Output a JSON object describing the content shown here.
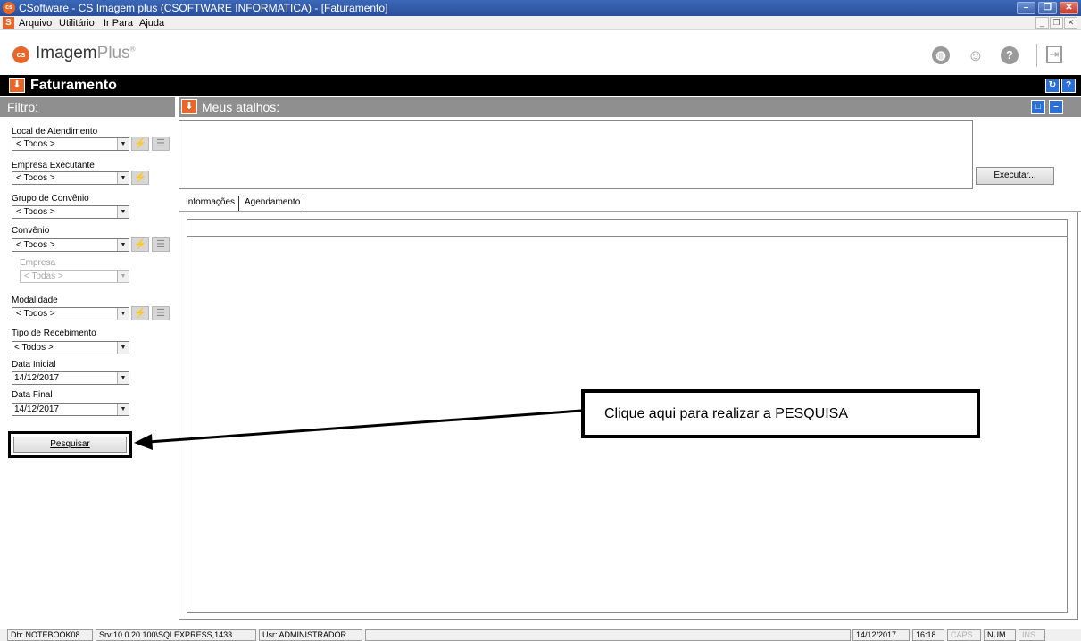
{
  "window": {
    "title": "CSoftware - CS Imagem plus (CSOFTWARE INFORMATICA) - [Faturamento]",
    "app_icon": "cs-logo-icon",
    "buttons": [
      "minimize",
      "restore",
      "close"
    ]
  },
  "menubar": {
    "items": [
      "Arquivo",
      "Utilitário",
      "Ir Para",
      "Ajuda"
    ]
  },
  "logo": {
    "name": "Imagem",
    "suffix": "Plus",
    "mark": "®"
  },
  "toolbar_icons": [
    "globe-icon",
    "support-user-icon",
    "help-icon",
    "exit-icon"
  ],
  "module": {
    "title": "Faturamento"
  },
  "filter": {
    "header": "Filtro:",
    "fields": [
      {
        "label": "Local de Atendimento",
        "value": "< Todos >"
      },
      {
        "label": "Empresa Executante",
        "value": "< Todos >"
      },
      {
        "label": "Grupo de Convênio",
        "value": "< Todos >"
      },
      {
        "label": "Convênio",
        "value": "< Todos >"
      },
      {
        "label": "Empresa",
        "value": "< Todas >"
      },
      {
        "label": "Modalidade",
        "value": "< Todos >"
      },
      {
        "label": "Tipo de Recebimento",
        "value": "< Todos >"
      },
      {
        "label": "Data Inicial",
        "value": "14/12/2017"
      },
      {
        "label": "Data Final",
        "value": "14/12/2017"
      }
    ],
    "search_button": "Pesquisar"
  },
  "shortcuts": {
    "header": "Meus atalhos:",
    "execute_button": "Executar..."
  },
  "tabs": [
    "Informações",
    "Agendamento"
  ],
  "annotation": {
    "text": "Clique aqui para realizar a PESQUISA"
  },
  "statusbar": {
    "db": "Db: NOTEBOOK08",
    "server": "Srv:10.0.20.100\\SQLEXPRESS,1433",
    "user": "Usr: ADMINISTRADOR",
    "date": "14/12/2017",
    "time": "16:18",
    "caps": "CAPS",
    "num": "NUM",
    "ins": "INS"
  }
}
